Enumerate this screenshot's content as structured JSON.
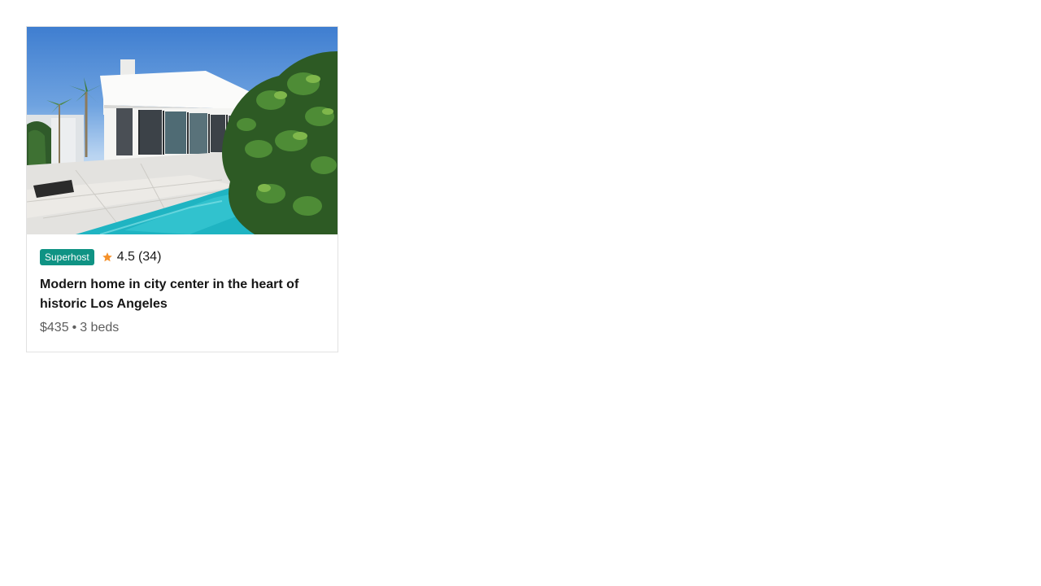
{
  "listing": {
    "badge": "Superhost",
    "rating": "4.5",
    "review_count": "(34)",
    "title": "Modern home in city center in the heart of historic Los Angeles",
    "price": "$435",
    "separator": "•",
    "beds": "3 beds",
    "photo_subject": "modern white villa with pool and palm trees"
  },
  "colors": {
    "badge_bg": "#0f9384",
    "star": "#f5912a",
    "title_text": "#161616",
    "meta_text": "#5e5e5e",
    "card_border": "#e2e2e2"
  },
  "icons": {
    "star": "star-icon"
  }
}
